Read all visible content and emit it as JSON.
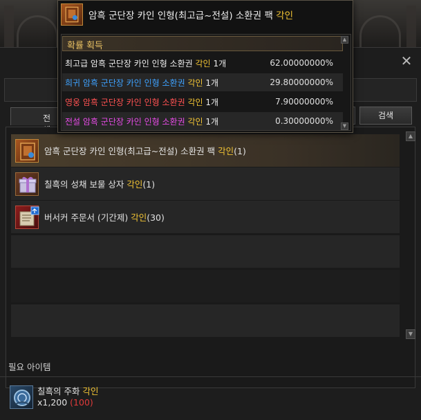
{
  "window": {
    "close_glyph": "✕"
  },
  "tabs": {
    "all_label": "전체"
  },
  "search": {
    "button_label": "검색"
  },
  "list": {
    "items": [
      {
        "name": "암흑 군단장 카인 인형(최고급~전설) 소환권 팩",
        "tag": "각인",
        "count": "(1)",
        "icon": "summon-pack-icon",
        "selected": true
      },
      {
        "name": "칠흑의 성채 보물 상자",
        "tag": "각인",
        "count": "(1)",
        "icon": "gift-box-icon",
        "selected": false
      },
      {
        "name": "버서커 주문서 (기간제)",
        "tag": "각인",
        "count": "(30)",
        "icon": "scroll-icon",
        "selected": false
      }
    ]
  },
  "required": {
    "title": "필요 아이템",
    "item_name": "칠흑의 주화",
    "item_tag": "각인",
    "quantity": "x1,200",
    "owned": "(100)",
    "icon": "coin-icon"
  },
  "tooltip": {
    "title": "암흑 군단장 카인 인형(최고급~전설) 소환권 팩",
    "title_tag": "각인",
    "section_label": "확률 획득",
    "rows": [
      {
        "name": "최고급 암흑 군단장 카인 인형 소환권",
        "tag": "각인",
        "qty": "1개",
        "prob": "62.00000000%",
        "color": "#ececec"
      },
      {
        "name": "희귀 암흑 군단장 카인 인형 소환권",
        "tag": "각인",
        "qty": "1개",
        "prob": "29.80000000%",
        "color": "#3ea2ff"
      },
      {
        "name": "영웅 암흑 군단장 카인 인형 소환권",
        "tag": "각인",
        "qty": "1개",
        "prob": "7.90000000%",
        "color": "#ff5252"
      },
      {
        "name": "전설 암흑 군단장 카인 인형 소환권",
        "tag": "각인",
        "qty": "1개",
        "prob": "0.30000000%",
        "color": "#e64be6"
      }
    ]
  },
  "colors": {
    "tag_gold": "#f2c434",
    "owned_red": "#e03a3a",
    "section_gold": "#e8c063"
  }
}
